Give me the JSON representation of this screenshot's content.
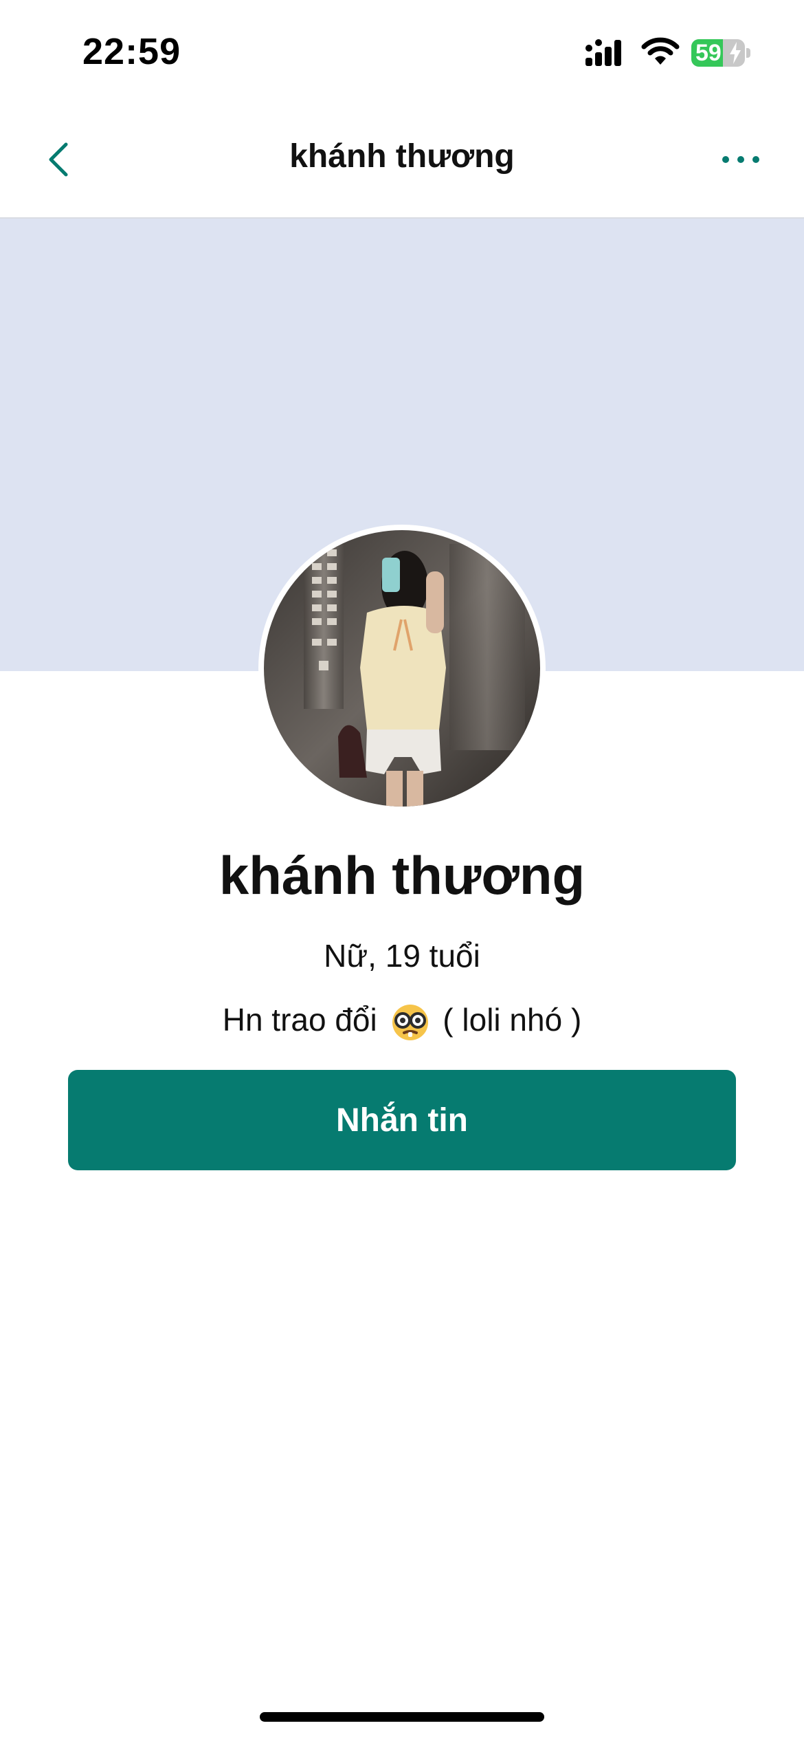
{
  "status_bar": {
    "time": "22:59",
    "battery_level": "59",
    "battery_percent": 59,
    "icons": [
      "signal-icon",
      "wifi-icon",
      "battery-icon",
      "battery-charging-icon"
    ]
  },
  "nav": {
    "title": "khánh thương",
    "back_icon": "chevron-left-icon",
    "more_icon": "more-horizontal-icon"
  },
  "profile": {
    "name": "khánh thương",
    "meta": "Nữ, 19 tuổi",
    "bio_before_emoji": "Hn trao đổi",
    "bio_emoji_icon": "nerd-face-emoji-icon",
    "bio_after_emoji": "( loli nhó )",
    "avatar_icon": "profile-photo"
  },
  "actions": {
    "message_label": "Nhắn tin"
  },
  "colors": {
    "accent": "#067b70",
    "cover": "#dde3f2",
    "battery_green": "#35c759"
  }
}
